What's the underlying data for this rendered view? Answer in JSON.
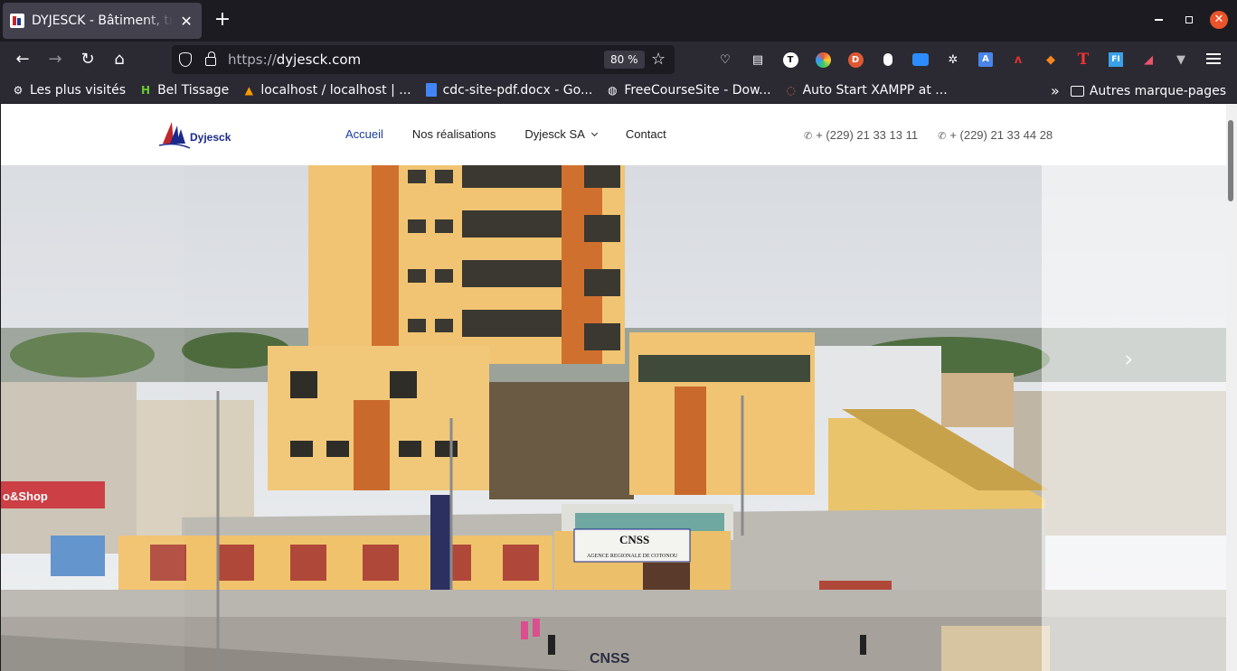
{
  "browser": {
    "tab": {
      "title": "DYJESCK - Bâtiment, travaux publics"
    },
    "url": {
      "scheme": "https://",
      "host": "dyjesck.com"
    },
    "zoom": "80 %",
    "bookmarks": [
      {
        "label": "Les plus visités",
        "icon": "gear-icon"
      },
      {
        "label": "Bel Tissage",
        "icon": "h-logo-icon"
      },
      {
        "label": "localhost / localhost | ...",
        "icon": "phpmyadmin-icon"
      },
      {
        "label": "cdc-site-pdf.docx - Go...",
        "icon": "docs-icon"
      },
      {
        "label": "FreeCourseSite - Dow...",
        "icon": "globe-icon"
      },
      {
        "label": "Auto Start XAMPP at ...",
        "icon": "loading-icon"
      }
    ],
    "other_bookmarks": "Autres marque-pages"
  },
  "site": {
    "logo_text": "Dyjesck",
    "nav": {
      "home": "Accueil",
      "projects": "Nos réalisations",
      "company": "Dyjesck SA",
      "contact": "Contact"
    },
    "phones": [
      "+ (229) 21 33 13 11",
      "+ (229) 21 33 44 28"
    ],
    "hero": {
      "caption": "CNSS",
      "sign_title": "CNSS",
      "sign_subtitle": "AGENCE REGIONALE DE COTONOU",
      "shop_sign": "o&Shop"
    }
  },
  "colors": {
    "accent": "#1b3d9e",
    "browser_dark": "#1c1b22",
    "toolbar": "#2b2a33",
    "close_red": "#e9542a"
  }
}
